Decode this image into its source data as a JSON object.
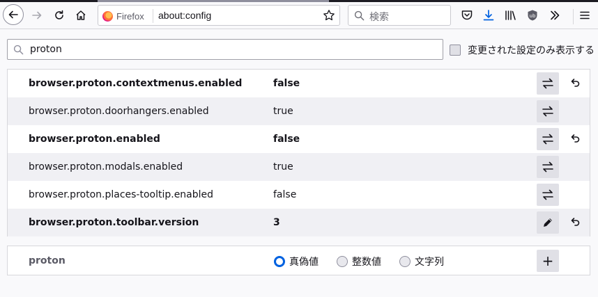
{
  "browser": {
    "identity_label": "Firefox",
    "url": "about:config",
    "search_placeholder": "検索",
    "icons": {
      "back": "arrow-left-icon",
      "forward": "arrow-right-icon",
      "reload": "reload-icon",
      "home": "home-icon",
      "bookmark": "star-icon",
      "pocket": "pocket-icon",
      "downloads": "download-icon",
      "library": "library-icon",
      "ublock": "ublock-origin-icon",
      "overflow": "chevron-double-right-icon",
      "menu": "hamburger-menu-icon"
    },
    "accent_color": "#0061e0"
  },
  "filter": {
    "value": "proton",
    "show_modified_label": "変更された設定のみ表示する",
    "show_modified_checked": false
  },
  "prefs": [
    {
      "name": "browser.proton.contextmenus.enabled",
      "value": "false",
      "modified": true,
      "action": "toggle"
    },
    {
      "name": "browser.proton.doorhangers.enabled",
      "value": "true",
      "modified": false,
      "action": "toggle"
    },
    {
      "name": "browser.proton.enabled",
      "value": "false",
      "modified": true,
      "action": "toggle"
    },
    {
      "name": "browser.proton.modals.enabled",
      "value": "true",
      "modified": false,
      "action": "toggle"
    },
    {
      "name": "browser.proton.places-tooltip.enabled",
      "value": "false",
      "modified": false,
      "action": "toggle"
    },
    {
      "name": "browser.proton.toolbar.version",
      "value": "3",
      "modified": true,
      "action": "edit"
    }
  ],
  "add_row": {
    "name": "proton",
    "types": [
      "真偽値",
      "整数値",
      "文字列"
    ],
    "selected_type": "真偽値",
    "add_label": "+"
  }
}
